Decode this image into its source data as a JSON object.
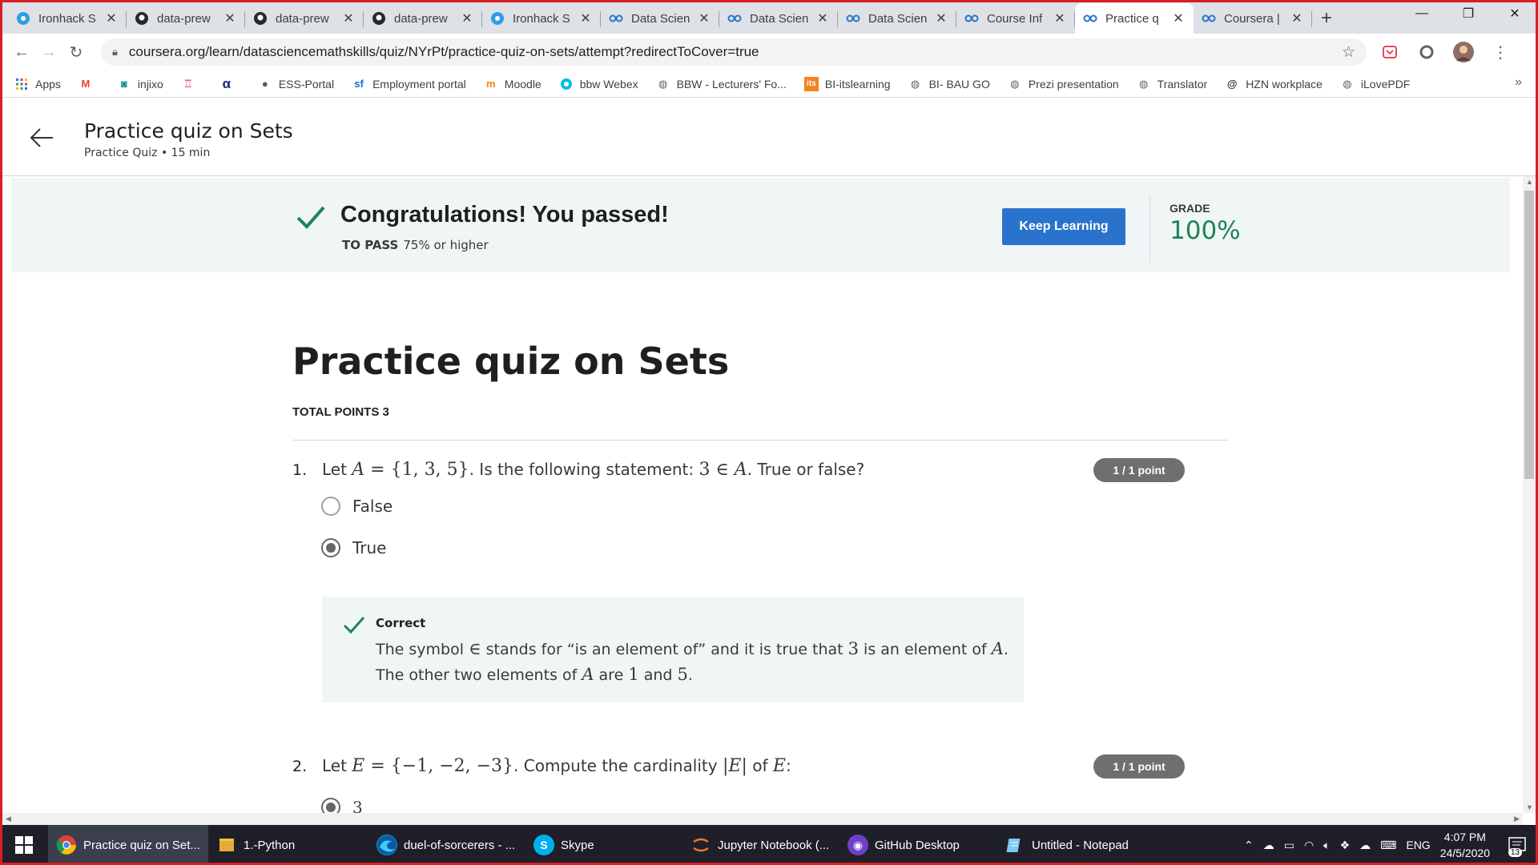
{
  "browser": {
    "tabs": [
      {
        "label": "Ironhack S",
        "icon": "ironhack-icon"
      },
      {
        "label": "data-prew",
        "icon": "github-icon"
      },
      {
        "label": "data-prew",
        "icon": "github-icon"
      },
      {
        "label": "data-prew",
        "icon": "github-icon"
      },
      {
        "label": "Ironhack S",
        "icon": "ironhack-icon"
      },
      {
        "label": "Data Scien",
        "icon": "coursera-icon"
      },
      {
        "label": "Data Scien",
        "icon": "coursera-icon"
      },
      {
        "label": "Data Scien",
        "icon": "coursera-icon"
      },
      {
        "label": "Course Inf",
        "icon": "coursera-icon"
      },
      {
        "label": "Practice q",
        "icon": "coursera-icon",
        "active": true
      },
      {
        "label": "Coursera |",
        "icon": "coursera-icon"
      }
    ],
    "url": "coursera.org/learn/datasciencemathskills/quiz/NYrPt/practice-quiz-on-sets/attempt?redirectToCover=true",
    "bookmarks": [
      {
        "label": "Apps"
      },
      {
        "label": ""
      },
      {
        "label": "injixo"
      },
      {
        "label": ""
      },
      {
        "label": ""
      },
      {
        "label": "ESS-Portal"
      },
      {
        "label": "Employment portal"
      },
      {
        "label": "Moodle"
      },
      {
        "label": "bbw Webex"
      },
      {
        "label": "BBW - Lecturers' Fo..."
      },
      {
        "label": "BI-itslearning"
      },
      {
        "label": "BI- BAU GO"
      },
      {
        "label": "Prezi presentation"
      },
      {
        "label": "Translator"
      },
      {
        "label": "HZN workplace"
      },
      {
        "label": "iLovePDF"
      }
    ],
    "more": "»"
  },
  "header": {
    "title": "Practice quiz on Sets",
    "subtitle": "Practice Quiz • 15 min"
  },
  "banner": {
    "message": "Congratulations! You passed!",
    "to_pass_label": "TO PASS",
    "to_pass_value": "75% or higher",
    "button": "Keep Learning",
    "grade_label": "GRADE",
    "grade_value": "100%",
    "accent": "#1f8354",
    "button_color": "#2a73cc"
  },
  "quiz": {
    "title": "Practice quiz on Sets",
    "total_points": "TOTAL POINTS 3",
    "q1": {
      "number": "1.",
      "text_a": "Let ",
      "math_a": "A",
      "math_b": " = {1, 3, 5}",
      "text_b": ". Is the following statement: ",
      "math_c": "3 ∈ ",
      "math_d": "A",
      "text_c": ". True or false?",
      "points": "1 / 1 point",
      "options": [
        "False",
        "True"
      ],
      "feedback_title": "Correct",
      "fb1": "The symbol ",
      "fb_m1": "∈",
      "fb2": " stands for “is an element of” and it is true that ",
      "fb_m2": "3",
      "fb3": " is an element of ",
      "fb_m3": "A",
      "fb4": ".",
      "fb5": "The other two elements of ",
      "fb_m4": "A",
      "fb6": " are ",
      "fb_m5": "1",
      "fb7": " and ",
      "fb_m6": "5",
      "fb8": "."
    },
    "q2": {
      "number": "2.",
      "text_a": "Let ",
      "math_a": "E",
      "math_b": " = {−1, −2, −3}",
      "text_b": ". Compute the cardinality ",
      "math_c": "|",
      "math_d": "E",
      "math_e": "|",
      "text_c": " of ",
      "math_f": "E",
      "text_d": ":",
      "points": "1 / 1 point",
      "partial_option": "3"
    }
  },
  "taskbar": {
    "items": [
      {
        "label": "Practice quiz on Set...",
        "icon": "chrome-icon"
      },
      {
        "label": "1.-Python",
        "icon": "folder-icon"
      },
      {
        "label": "duel-of-sorcerers - ...",
        "icon": "edge-icon"
      },
      {
        "label": "Skype",
        "icon": "skype-icon"
      },
      {
        "label": "Jupyter Notebook (...",
        "icon": "jupyter-icon"
      },
      {
        "label": "GitHub Desktop",
        "icon": "github-desktop-icon"
      },
      {
        "label": "Untitled - Notepad",
        "icon": "notepad-icon"
      }
    ],
    "lang": "ENG",
    "time": "4:07 PM",
    "date": "24/5/2020",
    "notifications": "13"
  }
}
